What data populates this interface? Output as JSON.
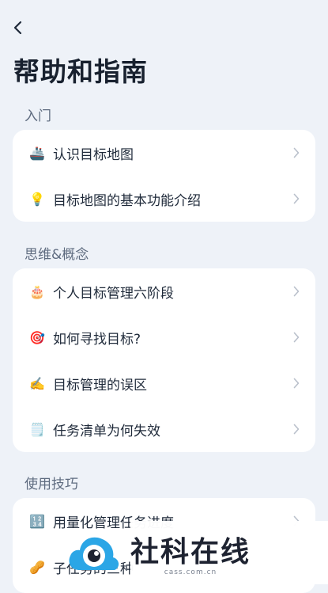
{
  "header": {
    "title": "帮助和指南"
  },
  "sections": [
    {
      "label": "入门",
      "items": [
        {
          "icon": "🚢",
          "label": "认识目标地图"
        },
        {
          "icon": "💡",
          "label": "目标地图的基本功能介绍"
        }
      ]
    },
    {
      "label": "思维&概念",
      "items": [
        {
          "icon": "🎂",
          "label": "个人目标管理六阶段"
        },
        {
          "icon": "🎯",
          "label": "如何寻找目标?"
        },
        {
          "icon": "✍️",
          "label": "目标管理的误区"
        },
        {
          "icon": "🗒️",
          "label": "任务清单为何失效"
        }
      ]
    },
    {
      "label": "使用技巧",
      "items": [
        {
          "icon": "🔢",
          "label": "用量化管理任务进度"
        },
        {
          "icon": "🥜",
          "label": "子任务的三种"
        }
      ]
    }
  ],
  "watermark": {
    "title": "社科在线",
    "url": "cass.com.cn"
  }
}
